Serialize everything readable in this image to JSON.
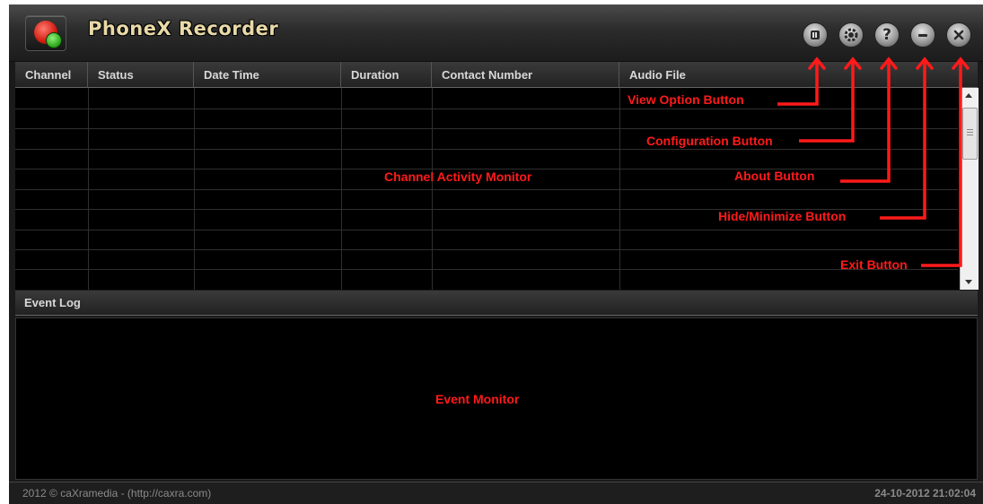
{
  "app": {
    "title": "PhoneX Recorder"
  },
  "toolbar": {
    "buttons": [
      {
        "name": "view-option",
        "icon": "list-icon"
      },
      {
        "name": "configuration",
        "icon": "gear-icon"
      },
      {
        "name": "about",
        "icon": "question-icon",
        "glyph": "?"
      },
      {
        "name": "minimize",
        "icon": "minimize-icon"
      },
      {
        "name": "exit",
        "icon": "close-icon"
      }
    ]
  },
  "table": {
    "columns": [
      "Channel",
      "Status",
      "Date Time",
      "Duration",
      "Contact Number",
      "Audio File"
    ],
    "rows": 10
  },
  "event_log": {
    "title": "Event Log"
  },
  "footer": {
    "copyright": "2012 © caXramedia - (http://caxra.com)",
    "datetime": "24-10-2012 21:02:04"
  },
  "annotations": {
    "view_option": "View Option Button",
    "configuration": "Configuration Button",
    "about": "About Button",
    "minimize": "Hide/Minimize Button",
    "exit": "Exit Button",
    "channel_monitor": "Channel Activity Monitor",
    "event_monitor": "Event Monitor"
  },
  "colors": {
    "annotation": "#ff1a1a",
    "title": "#e8d9a8",
    "background": "#000000"
  }
}
